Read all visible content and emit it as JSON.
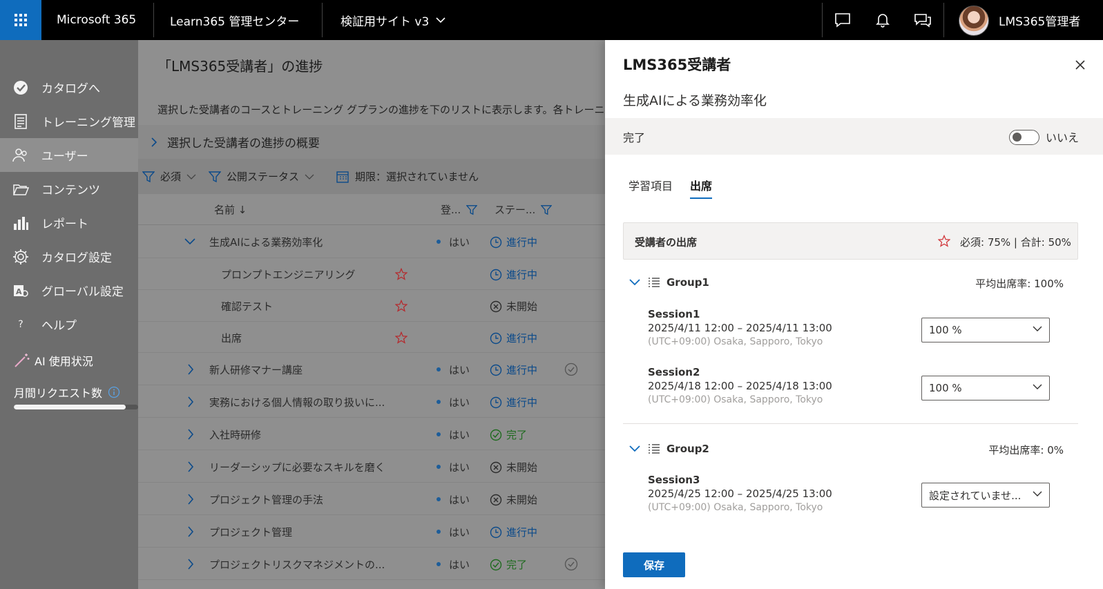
{
  "topbar": {
    "brand": "Microsoft 365",
    "app_title": "Learn365 管理センター",
    "site_selector": "検証用サイト v3",
    "user_name": "LMS365管理者",
    "icons": [
      "waffle-icon",
      "chat-icon",
      "bell-icon",
      "feedback-icon",
      "avatar"
    ]
  },
  "sidebar": {
    "items": [
      {
        "label": "カタログへ",
        "icon": "catalog-icon"
      },
      {
        "label": "トレーニング管理",
        "icon": "training-icon"
      },
      {
        "label": "ユーザー",
        "icon": "users-icon",
        "active": true
      },
      {
        "label": "コンテンツ",
        "icon": "folder-icon"
      },
      {
        "label": "レポート",
        "icon": "chart-icon"
      },
      {
        "label": "カタログ設定",
        "icon": "gear-icon"
      },
      {
        "label": "グローバル設定",
        "icon": "global-settings-icon"
      },
      {
        "label": "ヘルプ",
        "icon": "help-icon"
      }
    ],
    "ai_usage": "AI 使用状況",
    "monthly_requests": "月間リクエスト数",
    "monthly_requests_progress": 0.9
  },
  "main": {
    "title": "「LMS365受講者」の進捗",
    "description": "選択した受講者のコースとトレーニング グプランの進捗を下のリストに表示します。各トレーニ",
    "summary_toggle": "選択した受講者の進捗の概要",
    "filters": {
      "required": "必須",
      "publish_status": "公開ステータス",
      "deadline": "期限：選択されていません"
    },
    "columns": {
      "name": "名前 ↓",
      "enrolled": "登...",
      "status": "ステー..."
    },
    "rows": [
      {
        "name": "生成AIによる業務効率化",
        "enrolled": "はい",
        "status": "進行中",
        "status_kind": "progress",
        "expanded": true,
        "level": 0
      },
      {
        "name": "プロンプトエンジニアリング",
        "required": true,
        "status": "進行中",
        "status_kind": "progress",
        "level": 1
      },
      {
        "name": "確認テスト",
        "required": true,
        "status": "未開始",
        "status_kind": "notstarted",
        "level": 1
      },
      {
        "name": "出席",
        "required": true,
        "status": "進行中",
        "status_kind": "progress",
        "level": 1
      },
      {
        "name": "新人研修マナー講座",
        "enrolled": "はい",
        "status": "進行中",
        "status_kind": "progress",
        "check": true,
        "level": 0
      },
      {
        "name": "実務における個人情報の取り扱いに...",
        "enrolled": "はい",
        "status": "進行中",
        "status_kind": "progress",
        "level": 0
      },
      {
        "name": "入社時研修",
        "enrolled": "はい",
        "status": "完了",
        "status_kind": "done",
        "level": 0
      },
      {
        "name": "リーダーシップに必要なスキルを磨く",
        "enrolled": "はい",
        "status": "未開始",
        "status_kind": "notstarted",
        "level": 0
      },
      {
        "name": "プロジェクト管理の手法",
        "enrolled": "はい",
        "status": "未開始",
        "status_kind": "notstarted",
        "level": 0
      },
      {
        "name": "プロジェクト管理",
        "enrolled": "はい",
        "status": "進行中",
        "status_kind": "progress",
        "level": 0
      },
      {
        "name": "プロジェクトリスクマネジメントの...",
        "enrolled": "はい",
        "status": "完了",
        "status_kind": "done",
        "check": true,
        "level": 0
      }
    ]
  },
  "panel": {
    "user": "LMS365受講者",
    "course": "生成AIによる業務効率化",
    "complete_label": "完了",
    "complete_toggle_text": "いいえ",
    "tabs": [
      "学習項目",
      "出席"
    ],
    "active_tab": 1,
    "attendance_header": "受講者の出席",
    "attendance_summary": "必須: 75% | 合計: 50%",
    "groups": [
      {
        "name": "Group1",
        "avg": "平均出席率: 100%",
        "sessions": [
          {
            "name": "Session1",
            "date": "2025/4/11 12:00 – 2025/4/11 13:00",
            "tz": "(UTC+09:00) Osaka, Sapporo, Tokyo",
            "value": "100 %"
          },
          {
            "name": "Session2",
            "date": "2025/4/18 12:00 – 2025/4/18 13:00",
            "tz": "(UTC+09:00) Osaka, Sapporo, Tokyo",
            "value": "100 %"
          }
        ]
      },
      {
        "name": "Group2",
        "avg": "平均出席率: 0%",
        "sessions": [
          {
            "name": "Session3",
            "date": "2025/4/25 12:00 – 2025/4/25 13:00",
            "tz": "(UTC+09:00) Osaka, Sapporo, Tokyo",
            "value": "設定されていませ..."
          }
        ]
      }
    ],
    "save_label": "保存",
    "colors": {
      "accent": "#0f6cbd",
      "star": "#d13438",
      "progress": "#0f6cbd",
      "done": "#107c10"
    }
  }
}
